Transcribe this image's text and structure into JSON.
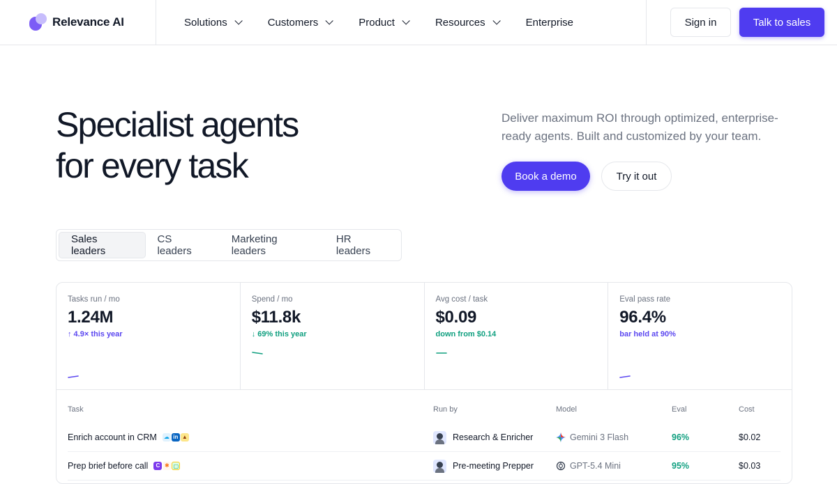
{
  "brand": {
    "name": "Relevance AI"
  },
  "nav": {
    "items": [
      {
        "label": "Solutions",
        "has_menu": true
      },
      {
        "label": "Customers",
        "has_menu": true
      },
      {
        "label": "Product",
        "has_menu": true
      },
      {
        "label": "Resources",
        "has_menu": true
      },
      {
        "label": "Enterprise",
        "has_menu": false
      }
    ],
    "signin_label": "Sign in",
    "talk_label": "Talk to sales"
  },
  "hero": {
    "title_line1": "Specialist agents",
    "title_line2": "for every task",
    "subtitle": "Deliver maximum ROI through optimized, enterprise-ready agents. Built and customized by your team.",
    "demo_label": "Book a demo",
    "try_label": "Try it out"
  },
  "tabs": [
    {
      "label": "Sales leaders",
      "active": true
    },
    {
      "label": "CS leaders",
      "active": false
    },
    {
      "label": "Marketing leaders",
      "active": false
    },
    {
      "label": "HR leaders",
      "active": false
    }
  ],
  "metrics": [
    {
      "label": "Tasks run / mo",
      "value": "1.24M",
      "delta": "↑ 4.9× this year",
      "tone": "purple"
    },
    {
      "label": "Spend / mo",
      "value": "$11.8k",
      "delta": "↓ 69% this year",
      "tone": "green"
    },
    {
      "label": "Avg cost / task",
      "value": "$0.09",
      "delta": "down from $0.14",
      "tone": "green"
    },
    {
      "label": "Eval pass rate",
      "value": "96.4%",
      "delta": "bar held at 90%",
      "tone": "purple"
    }
  ],
  "table": {
    "headers": {
      "task": "Task",
      "run_by": "Run by",
      "model": "Model",
      "eval": "Eval",
      "cost": "Cost"
    },
    "rows": [
      {
        "task": "Enrich account in CRM",
        "run_by": "Research & Enricher",
        "model": "Gemini 3 Flash",
        "model_icon": "gemini-icon",
        "eval": "96%",
        "cost": "$0.02"
      },
      {
        "task": "Prep brief before call",
        "run_by": "Pre-meeting Prepper",
        "model": "GPT-5.4 Mini",
        "model_icon": "openai-icon",
        "eval": "95%",
        "cost": "$0.03"
      }
    ]
  },
  "colors": {
    "accent": "#4f3cf0",
    "positive": "#0f9f7f",
    "border": "#e5e7eb"
  }
}
